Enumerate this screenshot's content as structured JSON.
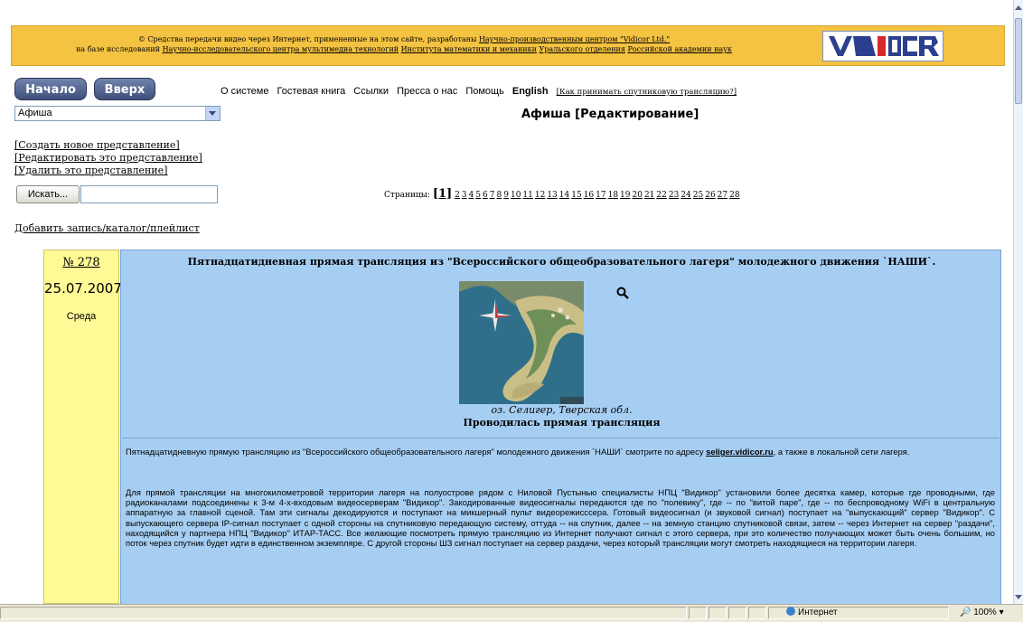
{
  "banner": {
    "line1_pre": "© Средства передачи видео через Интернет, примененные на этом сайте, разработаны ",
    "line1_link": "Научно-производственным центром \"Vidicor Ltd.\"",
    "line2_pre": "на базе исследований ",
    "line2_link1": "Научно-исследовательского центра мультимедиа технологий",
    "line2_link2": "Института математики и механики",
    "line2_link3": "Уральского отделения",
    "line2_link4": "Российской академии наук",
    "logo_text": "Vidicor"
  },
  "nav": {
    "start_label": "Начало",
    "up_label": "Вверх",
    "menu": [
      "О системе",
      "Гостевая книга",
      "Ссылки",
      "Пресса о нас",
      "Помощь"
    ],
    "english_label": "English",
    "satellite_link": "[Как принимать спутниковую трансляцию?]"
  },
  "section_select": {
    "value": "Афиша"
  },
  "page_title": "Афиша [Редактирование]",
  "actions": {
    "create": "[Создать новое представление]",
    "edit": "[Редактировать это представление]",
    "delete": "[Удалить это представление]",
    "search_button": "Искать...",
    "search_value": "",
    "add_record": "Добавить запись/каталог/плейлист"
  },
  "pagination": {
    "label": "Страницы:",
    "current": "[1]",
    "pages": [
      "2",
      "3",
      "4",
      "5",
      "6",
      "7",
      "8",
      "9",
      "10",
      "11",
      "12",
      "13",
      "14",
      "15",
      "16",
      "17",
      "18",
      "19",
      "20",
      "21",
      "22",
      "23",
      "24",
      "25",
      "26",
      "27",
      "28"
    ]
  },
  "event": {
    "number": "№ 278",
    "date": "25.07.2007",
    "weekday": "Среда",
    "title": "Пятнадцатидневная прямая трансляция из \"Всероссийского общеобразовательного лагеря\" молодежного движения `НАШИ`.",
    "image_caption": "оз. Селигер, Тверская обл.",
    "status": "Проводилась прямая трансляция",
    "desc_p1_pre": "Пятнадцатидневную прямую трансляцию из \"Всероссийского общеобразовательного лагеря\" молодежного движения `НАШИ` смотрите по адресу ",
    "desc_p1_link": "seliger.vidicor.ru",
    "desc_p1_post": ", а также в локальной сети лагеря.",
    "desc_p2": "Для прямой трансляции на многокилометровой территории лагеря на полуострове рядом с Ниловой Пустынью специалисты НПЦ \"Видикор\" установили более десятка камер, которые где проводными, где радиоканалами подсоединены к 3-м 4-х-входовым видеосерверам \"Видикор\". Закодированные видеосигналы передаются где по \"полевику\", где -- по \"витой паре\", где -- по беспроводному WiFi в центральную аппаратную за главной сценой. Там эти сигналы декодируются и поступают на микшерный пульт видеорежисссера. Готовый видеосигнал (и звуковой сигнал) поступает на \"выпускающий\" сервер \"Видикор\". С выпускающего сервера IP-сигнал поступает с одной стороны на спутниковую передающую систему, оттуда -- на спутник, далее -- на земную станцию спутниковой связи, затем -- через Интернет на сервер \"раздачи\", находящийся у партнера НПЦ \"Видикор\" ИТАР-ТАСС. Все желающие посмотреть прямую трансляцию из Интернет получают сигнал с этого сервера, при это количество получающих может быть очень большим, но поток через спутник будет идти в единственном экземпляре. С другой стороны ШЗ сигнал поступает на сервер раздачи, через который трансляции могут смотреть находящиеся на территории лагеря."
  },
  "statusbar": {
    "zone": "Интернет",
    "zoom": "100%"
  },
  "colors": {
    "banner_bg": "#f5c342",
    "event_bg": "#a6cef2",
    "date_bg": "#fff996",
    "nav_button": "#4f5f8c"
  },
  "icons": [
    "magnifier-icon",
    "globe-icon",
    "dropdown-arrow-icon"
  ]
}
